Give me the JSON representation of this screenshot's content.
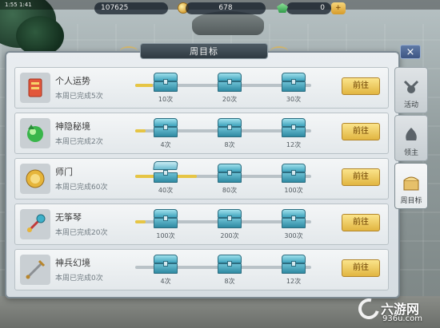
{
  "statusbar": {
    "text": "1:55 1:41"
  },
  "topbar": {
    "silver": "107625",
    "gold": "678",
    "gem": "0",
    "charge_label": "+"
  },
  "panel": {
    "title": "周目标",
    "close_label": "×"
  },
  "rows": [
    {
      "name": "个人运势",
      "progress": "本周已完成5次",
      "fill_ratio": 0.1,
      "tiers": [
        "10次",
        "20次",
        "30次"
      ],
      "button": "前往"
    },
    {
      "name": "神隐秘境",
      "progress": "本周已完成2次",
      "fill_ratio": 0.06,
      "tiers": [
        "4次",
        "8次",
        "12次"
      ],
      "button": "前往"
    },
    {
      "name": "师门",
      "progress": "本周已完成60次",
      "fill_ratio": 0.35,
      "tiers": [
        "40次",
        "80次",
        "100次"
      ],
      "button": "前往"
    },
    {
      "name": "无筝琴",
      "progress": "本周已完成20次",
      "fill_ratio": 0.06,
      "tiers": [
        "100次",
        "200次",
        "300次"
      ],
      "button": "前往"
    },
    {
      "name": "神兵幻境",
      "progress": "本周已完成0次",
      "fill_ratio": 0.0,
      "tiers": [
        "4次",
        "8次",
        "12次"
      ],
      "button": "前往"
    }
  ],
  "tabs": [
    {
      "label": "活动",
      "icon": "activity-icon"
    },
    {
      "label": "领主",
      "icon": "lord-icon"
    },
    {
      "label": "周目标",
      "icon": "weekly-goal-icon"
    }
  ],
  "watermark": {
    "text": "六游网",
    "url": "936u.com"
  },
  "colors": {
    "accent": "#e1b540",
    "progress": "#e6c544",
    "chest": "#3fa3bd"
  }
}
